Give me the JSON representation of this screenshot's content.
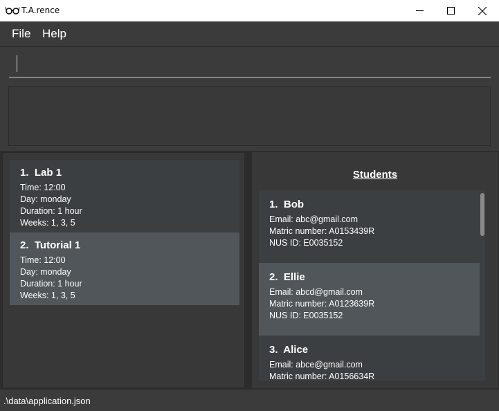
{
  "window": {
    "title": "T.A.rence",
    "app_icon": "glasses-icon",
    "controls": [
      "minimize-icon",
      "maximize-icon",
      "close-icon"
    ]
  },
  "menu": {
    "file": "File",
    "help": "Help"
  },
  "command": {
    "value": ""
  },
  "result": {
    "text": ""
  },
  "tutorials": [
    {
      "index": "1.",
      "name": "Lab 1",
      "time": "Time: 12:00",
      "day": "Day: monday",
      "duration": "Duration: 1 hour",
      "weeks": "Weeks: 1, 3, 5"
    },
    {
      "index": "2.",
      "name": "Tutorial 1",
      "time": "Time: 12:00",
      "day": "Day: monday",
      "duration": "Duration: 1 hour",
      "weeks": "Weeks: 1, 3, 5"
    }
  ],
  "students_panel": {
    "title": "Students",
    "items": [
      {
        "index": "1.",
        "name": "Bob",
        "email": "Email: abc@gmail.com",
        "matric": "Matric number: A0153439R",
        "nusid": "NUS ID: E0035152"
      },
      {
        "index": "2.",
        "name": "Ellie",
        "email": "Email: abcd@gmail.com",
        "matric": "Matric number: A0123639R",
        "nusid": "NUS ID: E0035152"
      },
      {
        "index": "3.",
        "name": "Alice",
        "email": "Email: abce@gmail.com",
        "matric": "Matric number: A0156634R",
        "nusid": ""
      }
    ]
  },
  "status": {
    "path": ".\\data\\application.json"
  },
  "colors": {
    "background": "#2d2d2d",
    "panel": "#3b3b3b",
    "card_even": "#3c3f41",
    "card_odd": "#505659"
  }
}
